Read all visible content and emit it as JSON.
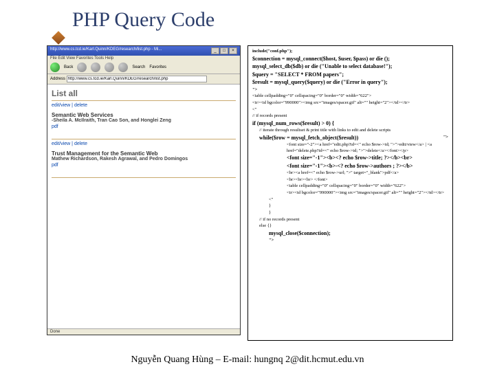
{
  "slide": {
    "title": "PHP Query Code",
    "footer": "Nguyễn Quang Hùng – E-mail: hungnq 2@dit.hcmut.edu.vn"
  },
  "browser": {
    "window_title": "http://www.cs.tcd.ie/Karl.Quinn/KDEG/research/list.php - Mi...",
    "menu": "File   Edit   View   Favorites   Tools   Help",
    "back_label": "Back",
    "search_label": "Search",
    "fav_label": "Favorites",
    "addr_label": "Address",
    "url": "http://www.cs.tcd.ie/Karl.Quinn/KDEG/research/list.php",
    "list_heading": "List all",
    "edit_view": "edit/view | delete",
    "papers": [
      {
        "title": "Semantic Web Services",
        "authors": "-Sheila A. McIlraith, Tran Cao Son, and Honglei Zeng",
        "link": "pdf"
      },
      {
        "title": "Trust Management for the Semantic Web",
        "authors": "Mathew Richardson, Rakesh Agrawal, and Pedro Domingos",
        "link": "pdf"
      }
    ],
    "status": "Done"
  },
  "code": {
    "l1": "include(\"conf.php\");",
    "l2": "$connection = mysql_connect($host, $user, $pass) or die ();",
    "l3": "mysql_select_db($db) or die (\"Unable to select database!\");",
    "l4": "$query = \"SELECT * FROM papers\";",
    "l5": "$result = mysql_query($query) or die (\"Error in query\");",
    "l6": "\">",
    "l7": "<table cellpadding=\"0\" cellspacing=\"0\" border=\"0\" width=\"622\">",
    "l8": "<tr><td bgcolor=\"990000\"><img src=\"images/spacer.gif\" alt=\"\" height=\"2\"></td></tr>",
    "l9": "<\"",
    "l10": "// if records present",
    "l11": "if (mysql_num_rows($result) > 0)   {",
    "l12": "// iterate through resultset & print title with links to edit and delete scripts",
    "l13a": "while($row = mysql_fetch_object($result))",
    "l13b": "\">",
    "l14": "<font size=\"-2\"><a href=\"edit.php?id=<\" echo $row->id; \">\">edit/view</a>  |  <a href=\"delete.php?id=<\" echo $row->id; \">\">delete</a></font></p>",
    "l15": "<font size=\"-1\"><b><? echo $row->title;  ?></b><br>",
    "l16": "<font size=\"-1\"><b>-<? echo $row->authors ;  ?></b>",
    "l17": "<br><a href=<\" echo $row->url; \">\" target=\"_blank\">pdf</a>",
    "l18": "<br><br><br>  </font>",
    "l19": "<table cellpadding=\"0\" cellspacing=\"0\" border=\"0\" width=\"622\">",
    "l20": "<tr><td bgcolor=\"990000\"><img src=\"images/spacer.gif\" alt=\"\" height=\"2\"></td></tr>",
    "l21": "<\"",
    "l22": "}",
    "l23": "}",
    "l24": "// if no records present",
    "l25": "else {}",
    "l26": "mysql_close($connection);",
    "l27": "\">"
  }
}
